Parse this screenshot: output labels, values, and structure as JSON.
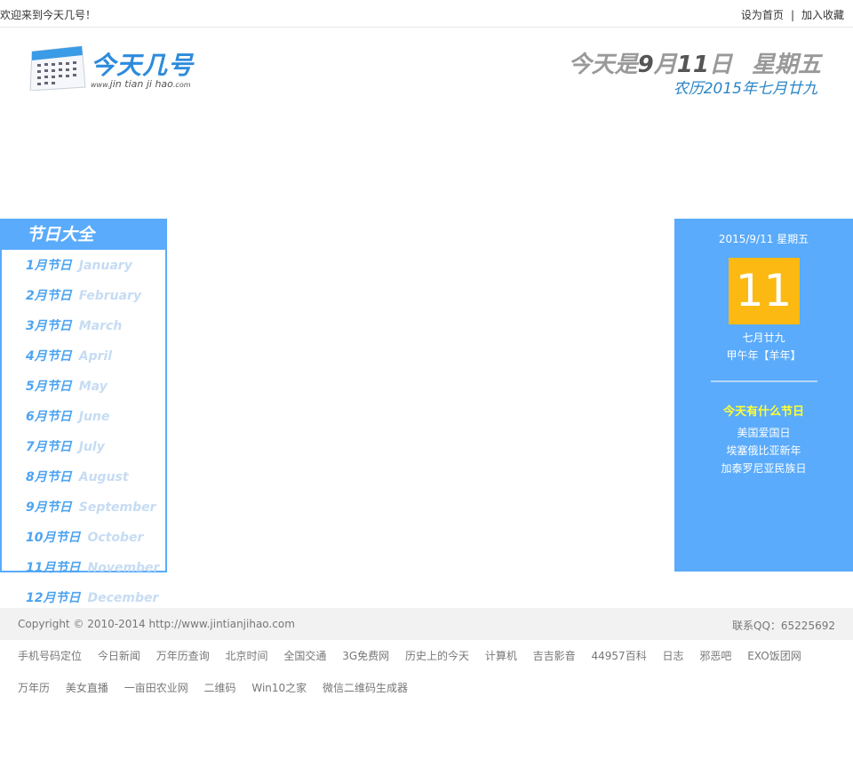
{
  "topbar": {
    "welcome": "欢迎来到今天几号！",
    "set_home": "设为首页",
    "separator": "|",
    "bookmark": "加入收藏"
  },
  "logo": {
    "title": "今天几号",
    "sub_prefix": "www.",
    "sub_main": "jin tian ji hao",
    "sub_suffix": ".com"
  },
  "today": {
    "prefix": "今天是",
    "month_num": "9",
    "month_unit": "月",
    "day_num": "11",
    "day_unit": "日",
    "weekday": "星期五",
    "lunar": "农历2015年七月廿九"
  },
  "festival": {
    "title": "节日大全",
    "months": [
      {
        "cn": "1月节日",
        "en": "January"
      },
      {
        "cn": "2月节日",
        "en": "February"
      },
      {
        "cn": "3月节日",
        "en": "March"
      },
      {
        "cn": "4月节日",
        "en": "April"
      },
      {
        "cn": "5月节日",
        "en": "May"
      },
      {
        "cn": "6月节日",
        "en": "June"
      },
      {
        "cn": "7月节日",
        "en": "July"
      },
      {
        "cn": "8月节日",
        "en": "August"
      },
      {
        "cn": "9月节日",
        "en": "September"
      },
      {
        "cn": "10月节日",
        "en": "October"
      },
      {
        "cn": "11月节日",
        "en": "November"
      },
      {
        "cn": "12月节日",
        "en": "December"
      }
    ]
  },
  "datecard": {
    "date": "2015/9/11 星期五",
    "day": "11",
    "lunar_day": "七月廿九",
    "ganzhi": "甲午年【羊年】",
    "fest_title": "今天有什么节日",
    "fests": [
      "美国爱国日",
      "埃塞俄比亚新年",
      "加泰罗尼亚民族日"
    ]
  },
  "footer": {
    "copyright": "Copyright © 2010-2014 http://www.jintianjihao.com",
    "qq": "联系QQ：65225692"
  },
  "links": [
    "手机号码定位",
    "今日新闻",
    "万年历查询",
    "北京时间",
    "全国交通",
    "3G免费网",
    "历史上的今天",
    "计算机",
    "吉吉影音",
    "44957百科",
    "日志",
    "邪恶吧",
    "EXO饭团网",
    "万年历",
    "美女直播",
    "一亩田农业网",
    "二维码",
    "Win10之家",
    "微信二维码生成器"
  ],
  "colors": {
    "accent": "#5aabfb",
    "logo": "#2d8bdc",
    "highlight": "#fbb912",
    "fest_title": "#ffff33"
  }
}
